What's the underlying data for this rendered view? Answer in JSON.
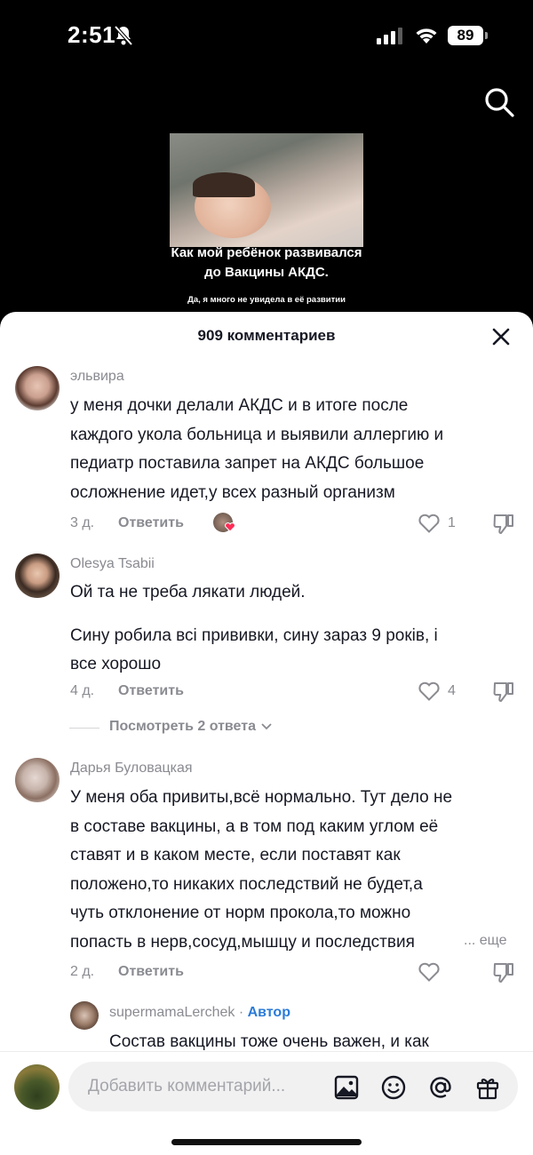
{
  "status_bar": {
    "time": "2:51",
    "battery": "89"
  },
  "video": {
    "title_line1": "Как мой ребёнок развивался",
    "title_line2": "до Вакцины АКДС.",
    "subtitle": "Да, я много не увидела в её развитии"
  },
  "sheet": {
    "title": "909 комментариев"
  },
  "comments": [
    {
      "user": "эльвира",
      "lines": [
        "у меня дочки делали АКДС и в итоге после",
        "каждого укола больница и выявили аллергию и",
        "педиатр поставила запрет на АКДС большое",
        "осложнение идет,у всех разный организм"
      ],
      "date": "3 д.",
      "reply": "Ответить",
      "likes": "1"
    },
    {
      "user": "Olesya  Tsabii",
      "lines": [
        "Ой та не треба лякати людей.",
        "",
        "Сину робила всі прививки, сину зараз 9 років, і",
        "все хорошо"
      ],
      "date": "4 д.",
      "reply": "Ответить",
      "likes": "4",
      "view_replies": "Посмотреть 2 ответа"
    },
    {
      "user": "Дарья Буловацкая",
      "lines": [
        "У меня оба привиты,всё нормально. Тут дело не",
        "в составе вакцины, а в том под каким углом её",
        "ставят и в каком месте, если поставят как",
        "положено,то никаких последствий не будет,а",
        "чуть отклонение от норм прокола,то можно",
        "попасть в нерв,сосуд,мышцу и последствия"
      ],
      "more": "... еще",
      "date": "2 д.",
      "reply": "Ответить"
    }
  ],
  "author_reply": {
    "user": "supermamaLerchek",
    "separator": " · ",
    "badge": "Автор",
    "text": "Состав вакцины тоже очень важен, и как"
  },
  "input": {
    "placeholder": "Добавить комментарий..."
  }
}
